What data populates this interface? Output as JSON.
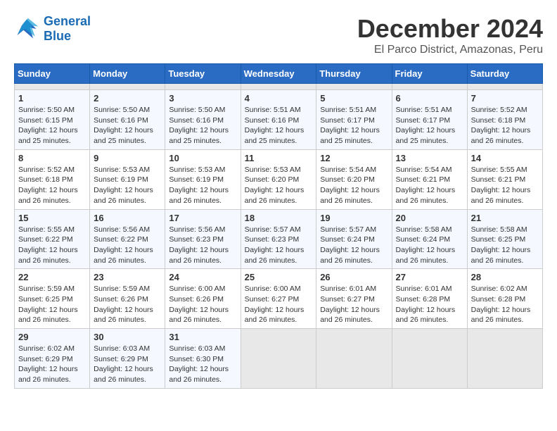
{
  "header": {
    "logo_line1": "General",
    "logo_line2": "Blue",
    "title": "December 2024",
    "subtitle": "El Parco District, Amazonas, Peru"
  },
  "calendar": {
    "days_of_week": [
      "Sunday",
      "Monday",
      "Tuesday",
      "Wednesday",
      "Thursday",
      "Friday",
      "Saturday"
    ],
    "weeks": [
      [
        {
          "day": "",
          "info": ""
        },
        {
          "day": "",
          "info": ""
        },
        {
          "day": "",
          "info": ""
        },
        {
          "day": "",
          "info": ""
        },
        {
          "day": "",
          "info": ""
        },
        {
          "day": "",
          "info": ""
        },
        {
          "day": "",
          "info": ""
        }
      ],
      [
        {
          "day": "1",
          "info": "Sunrise: 5:50 AM\nSunset: 6:15 PM\nDaylight: 12 hours\nand 25 minutes."
        },
        {
          "day": "2",
          "info": "Sunrise: 5:50 AM\nSunset: 6:16 PM\nDaylight: 12 hours\nand 25 minutes."
        },
        {
          "day": "3",
          "info": "Sunrise: 5:50 AM\nSunset: 6:16 PM\nDaylight: 12 hours\nand 25 minutes."
        },
        {
          "day": "4",
          "info": "Sunrise: 5:51 AM\nSunset: 6:16 PM\nDaylight: 12 hours\nand 25 minutes."
        },
        {
          "day": "5",
          "info": "Sunrise: 5:51 AM\nSunset: 6:17 PM\nDaylight: 12 hours\nand 25 minutes."
        },
        {
          "day": "6",
          "info": "Sunrise: 5:51 AM\nSunset: 6:17 PM\nDaylight: 12 hours\nand 25 minutes."
        },
        {
          "day": "7",
          "info": "Sunrise: 5:52 AM\nSunset: 6:18 PM\nDaylight: 12 hours\nand 26 minutes."
        }
      ],
      [
        {
          "day": "8",
          "info": "Sunrise: 5:52 AM\nSunset: 6:18 PM\nDaylight: 12 hours\nand 26 minutes."
        },
        {
          "day": "9",
          "info": "Sunrise: 5:53 AM\nSunset: 6:19 PM\nDaylight: 12 hours\nand 26 minutes."
        },
        {
          "day": "10",
          "info": "Sunrise: 5:53 AM\nSunset: 6:19 PM\nDaylight: 12 hours\nand 26 minutes."
        },
        {
          "day": "11",
          "info": "Sunrise: 5:53 AM\nSunset: 6:20 PM\nDaylight: 12 hours\nand 26 minutes."
        },
        {
          "day": "12",
          "info": "Sunrise: 5:54 AM\nSunset: 6:20 PM\nDaylight: 12 hours\nand 26 minutes."
        },
        {
          "day": "13",
          "info": "Sunrise: 5:54 AM\nSunset: 6:21 PM\nDaylight: 12 hours\nand 26 minutes."
        },
        {
          "day": "14",
          "info": "Sunrise: 5:55 AM\nSunset: 6:21 PM\nDaylight: 12 hours\nand 26 minutes."
        }
      ],
      [
        {
          "day": "15",
          "info": "Sunrise: 5:55 AM\nSunset: 6:22 PM\nDaylight: 12 hours\nand 26 minutes."
        },
        {
          "day": "16",
          "info": "Sunrise: 5:56 AM\nSunset: 6:22 PM\nDaylight: 12 hours\nand 26 minutes."
        },
        {
          "day": "17",
          "info": "Sunrise: 5:56 AM\nSunset: 6:23 PM\nDaylight: 12 hours\nand 26 minutes."
        },
        {
          "day": "18",
          "info": "Sunrise: 5:57 AM\nSunset: 6:23 PM\nDaylight: 12 hours\nand 26 minutes."
        },
        {
          "day": "19",
          "info": "Sunrise: 5:57 AM\nSunset: 6:24 PM\nDaylight: 12 hours\nand 26 minutes."
        },
        {
          "day": "20",
          "info": "Sunrise: 5:58 AM\nSunset: 6:24 PM\nDaylight: 12 hours\nand 26 minutes."
        },
        {
          "day": "21",
          "info": "Sunrise: 5:58 AM\nSunset: 6:25 PM\nDaylight: 12 hours\nand 26 minutes."
        }
      ],
      [
        {
          "day": "22",
          "info": "Sunrise: 5:59 AM\nSunset: 6:25 PM\nDaylight: 12 hours\nand 26 minutes."
        },
        {
          "day": "23",
          "info": "Sunrise: 5:59 AM\nSunset: 6:26 PM\nDaylight: 12 hours\nand 26 minutes."
        },
        {
          "day": "24",
          "info": "Sunrise: 6:00 AM\nSunset: 6:26 PM\nDaylight: 12 hours\nand 26 minutes."
        },
        {
          "day": "25",
          "info": "Sunrise: 6:00 AM\nSunset: 6:27 PM\nDaylight: 12 hours\nand 26 minutes."
        },
        {
          "day": "26",
          "info": "Sunrise: 6:01 AM\nSunset: 6:27 PM\nDaylight: 12 hours\nand 26 minutes."
        },
        {
          "day": "27",
          "info": "Sunrise: 6:01 AM\nSunset: 6:28 PM\nDaylight: 12 hours\nand 26 minutes."
        },
        {
          "day": "28",
          "info": "Sunrise: 6:02 AM\nSunset: 6:28 PM\nDaylight: 12 hours\nand 26 minutes."
        }
      ],
      [
        {
          "day": "29",
          "info": "Sunrise: 6:02 AM\nSunset: 6:29 PM\nDaylight: 12 hours\nand 26 minutes."
        },
        {
          "day": "30",
          "info": "Sunrise: 6:03 AM\nSunset: 6:29 PM\nDaylight: 12 hours\nand 26 minutes."
        },
        {
          "day": "31",
          "info": "Sunrise: 6:03 AM\nSunset: 6:30 PM\nDaylight: 12 hours\nand 26 minutes."
        },
        {
          "day": "",
          "info": ""
        },
        {
          "day": "",
          "info": ""
        },
        {
          "day": "",
          "info": ""
        },
        {
          "day": "",
          "info": ""
        }
      ]
    ]
  }
}
